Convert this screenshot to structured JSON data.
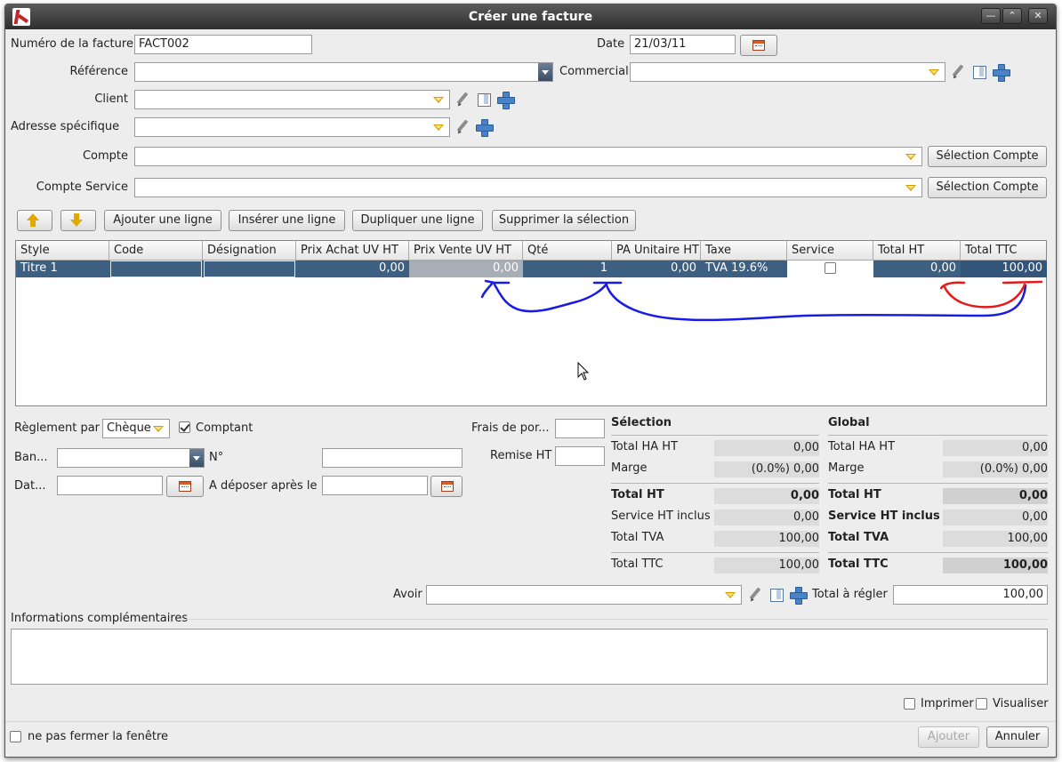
{
  "window": {
    "title": "Créer une facture"
  },
  "header": {
    "invoice_number_label": "Numéro de la facture",
    "invoice_number_value": "FACT002",
    "date_label": "Date",
    "date_value": "21/03/11",
    "reference_label": "Référence",
    "commercial_label": "Commercial",
    "client_label": "Client",
    "address_label": "Adresse spécifique",
    "account_label": "Compte",
    "account_button": "Sélection Compte",
    "service_account_label": "Compte Service",
    "service_account_button": "Sélection Compte"
  },
  "toolbar": {
    "add_line": "Ajouter une ligne",
    "insert_line": "Insérer une ligne",
    "duplicate_line": "Dupliquer une ligne",
    "delete_selection": "Supprimer la sélection"
  },
  "table": {
    "columns": [
      "Style",
      "Code",
      "Désignation",
      "Prix Achat UV HT",
      "Prix Vente UV HT",
      "Qté",
      "PA Unitaire HT",
      "Taxe",
      "Service",
      "Total HT",
      "Total TTC"
    ],
    "rows": [
      {
        "style": "Titre 1",
        "code": "",
        "designation": "",
        "prix_achat": "0,00",
        "prix_vente": "0,00",
        "qte": "1",
        "pa_unitaire": "0,00",
        "taxe": "TVA 19.6%",
        "service": false,
        "total_ht": "0,00",
        "total_ttc": "100,00"
      }
    ]
  },
  "payment": {
    "reglement_label": "Règlement par",
    "reglement_value": "Chèque",
    "comptant_label": "Comptant",
    "comptant_checked": true,
    "banque_label": "Ban...",
    "numero_label": "N°",
    "date_label": "Dat...",
    "deposer_label": "A déposer après le",
    "frais_label": "Frais de por...",
    "remise_label": "Remise HT"
  },
  "totals": {
    "selection_title": "Sélection",
    "global_title": "Global",
    "selection": {
      "total_ha_ht_label": "Total HA HT",
      "total_ha_ht": "0,00",
      "marge_label": "Marge",
      "marge": "(0.0%) 0,00",
      "total_ht_label": "Total HT",
      "total_ht": "0,00",
      "service_label": "Service HT inclus",
      "service": "0,00",
      "tva_label": "Total TVA",
      "tva": "100,00",
      "ttc_label": "Total TTC",
      "ttc": "100,00"
    },
    "global": {
      "total_ha_ht_label": "Total HA HT",
      "total_ha_ht": "0,00",
      "marge_label": "Marge",
      "marge": "(0.0%) 0,00",
      "total_ht_label": "Total HT",
      "total_ht": "0,00",
      "service_label": "Service HT inclus",
      "service": "0,00",
      "tva_label": "Total TVA",
      "tva": "100,00",
      "ttc_label": "Total TTC",
      "ttc": "100,00"
    }
  },
  "avoir": {
    "label": "Avoir",
    "total_label": "Total à régler",
    "total_value": "100,00"
  },
  "info": {
    "label": "Informations complémentaires"
  },
  "footer": {
    "print_label": "Imprimer",
    "preview_label": "Visualiser",
    "keep_open_label": "ne pas fermer la fenêtre",
    "add_button": "Ajouter",
    "cancel_button": "Annuler"
  },
  "annotation_colors": {
    "blue": "#1a1ae6",
    "red": "#e61a1a"
  }
}
